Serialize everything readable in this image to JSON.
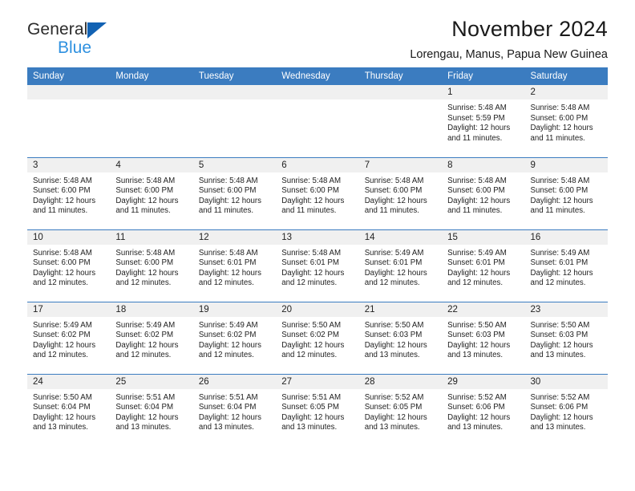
{
  "brand": {
    "name_part1": "General",
    "name_part2": "Blue",
    "triangle_color": "#1262b3",
    "blue_color": "#2f91e0"
  },
  "header": {
    "title": "November 2024",
    "subtitle": "Lorengau, Manus, Papua New Guinea"
  },
  "colors": {
    "header_blue": "#3b7cc0",
    "daynum_band": "#f0f0f0",
    "text": "#222222"
  },
  "weekdays": [
    "Sunday",
    "Monday",
    "Tuesday",
    "Wednesday",
    "Thursday",
    "Friday",
    "Saturday"
  ],
  "weeks": [
    [
      {
        "day": "",
        "sunrise": "",
        "sunset": "",
        "daylight1": "",
        "daylight2": ""
      },
      {
        "day": "",
        "sunrise": "",
        "sunset": "",
        "daylight1": "",
        "daylight2": ""
      },
      {
        "day": "",
        "sunrise": "",
        "sunset": "",
        "daylight1": "",
        "daylight2": ""
      },
      {
        "day": "",
        "sunrise": "",
        "sunset": "",
        "daylight1": "",
        "daylight2": ""
      },
      {
        "day": "",
        "sunrise": "",
        "sunset": "",
        "daylight1": "",
        "daylight2": ""
      },
      {
        "day": "1",
        "sunrise": "Sunrise: 5:48 AM",
        "sunset": "Sunset: 5:59 PM",
        "daylight1": "Daylight: 12 hours",
        "daylight2": "and 11 minutes."
      },
      {
        "day": "2",
        "sunrise": "Sunrise: 5:48 AM",
        "sunset": "Sunset: 6:00 PM",
        "daylight1": "Daylight: 12 hours",
        "daylight2": "and 11 minutes."
      }
    ],
    [
      {
        "day": "3",
        "sunrise": "Sunrise: 5:48 AM",
        "sunset": "Sunset: 6:00 PM",
        "daylight1": "Daylight: 12 hours",
        "daylight2": "and 11 minutes."
      },
      {
        "day": "4",
        "sunrise": "Sunrise: 5:48 AM",
        "sunset": "Sunset: 6:00 PM",
        "daylight1": "Daylight: 12 hours",
        "daylight2": "and 11 minutes."
      },
      {
        "day": "5",
        "sunrise": "Sunrise: 5:48 AM",
        "sunset": "Sunset: 6:00 PM",
        "daylight1": "Daylight: 12 hours",
        "daylight2": "and 11 minutes."
      },
      {
        "day": "6",
        "sunrise": "Sunrise: 5:48 AM",
        "sunset": "Sunset: 6:00 PM",
        "daylight1": "Daylight: 12 hours",
        "daylight2": "and 11 minutes."
      },
      {
        "day": "7",
        "sunrise": "Sunrise: 5:48 AM",
        "sunset": "Sunset: 6:00 PM",
        "daylight1": "Daylight: 12 hours",
        "daylight2": "and 11 minutes."
      },
      {
        "day": "8",
        "sunrise": "Sunrise: 5:48 AM",
        "sunset": "Sunset: 6:00 PM",
        "daylight1": "Daylight: 12 hours",
        "daylight2": "and 11 minutes."
      },
      {
        "day": "9",
        "sunrise": "Sunrise: 5:48 AM",
        "sunset": "Sunset: 6:00 PM",
        "daylight1": "Daylight: 12 hours",
        "daylight2": "and 11 minutes."
      }
    ],
    [
      {
        "day": "10",
        "sunrise": "Sunrise: 5:48 AM",
        "sunset": "Sunset: 6:00 PM",
        "daylight1": "Daylight: 12 hours",
        "daylight2": "and 12 minutes."
      },
      {
        "day": "11",
        "sunrise": "Sunrise: 5:48 AM",
        "sunset": "Sunset: 6:00 PM",
        "daylight1": "Daylight: 12 hours",
        "daylight2": "and 12 minutes."
      },
      {
        "day": "12",
        "sunrise": "Sunrise: 5:48 AM",
        "sunset": "Sunset: 6:01 PM",
        "daylight1": "Daylight: 12 hours",
        "daylight2": "and 12 minutes."
      },
      {
        "day": "13",
        "sunrise": "Sunrise: 5:48 AM",
        "sunset": "Sunset: 6:01 PM",
        "daylight1": "Daylight: 12 hours",
        "daylight2": "and 12 minutes."
      },
      {
        "day": "14",
        "sunrise": "Sunrise: 5:49 AM",
        "sunset": "Sunset: 6:01 PM",
        "daylight1": "Daylight: 12 hours",
        "daylight2": "and 12 minutes."
      },
      {
        "day": "15",
        "sunrise": "Sunrise: 5:49 AM",
        "sunset": "Sunset: 6:01 PM",
        "daylight1": "Daylight: 12 hours",
        "daylight2": "and 12 minutes."
      },
      {
        "day": "16",
        "sunrise": "Sunrise: 5:49 AM",
        "sunset": "Sunset: 6:01 PM",
        "daylight1": "Daylight: 12 hours",
        "daylight2": "and 12 minutes."
      }
    ],
    [
      {
        "day": "17",
        "sunrise": "Sunrise: 5:49 AM",
        "sunset": "Sunset: 6:02 PM",
        "daylight1": "Daylight: 12 hours",
        "daylight2": "and 12 minutes."
      },
      {
        "day": "18",
        "sunrise": "Sunrise: 5:49 AM",
        "sunset": "Sunset: 6:02 PM",
        "daylight1": "Daylight: 12 hours",
        "daylight2": "and 12 minutes."
      },
      {
        "day": "19",
        "sunrise": "Sunrise: 5:49 AM",
        "sunset": "Sunset: 6:02 PM",
        "daylight1": "Daylight: 12 hours",
        "daylight2": "and 12 minutes."
      },
      {
        "day": "20",
        "sunrise": "Sunrise: 5:50 AM",
        "sunset": "Sunset: 6:02 PM",
        "daylight1": "Daylight: 12 hours",
        "daylight2": "and 12 minutes."
      },
      {
        "day": "21",
        "sunrise": "Sunrise: 5:50 AM",
        "sunset": "Sunset: 6:03 PM",
        "daylight1": "Daylight: 12 hours",
        "daylight2": "and 13 minutes."
      },
      {
        "day": "22",
        "sunrise": "Sunrise: 5:50 AM",
        "sunset": "Sunset: 6:03 PM",
        "daylight1": "Daylight: 12 hours",
        "daylight2": "and 13 minutes."
      },
      {
        "day": "23",
        "sunrise": "Sunrise: 5:50 AM",
        "sunset": "Sunset: 6:03 PM",
        "daylight1": "Daylight: 12 hours",
        "daylight2": "and 13 minutes."
      }
    ],
    [
      {
        "day": "24",
        "sunrise": "Sunrise: 5:50 AM",
        "sunset": "Sunset: 6:04 PM",
        "daylight1": "Daylight: 12 hours",
        "daylight2": "and 13 minutes."
      },
      {
        "day": "25",
        "sunrise": "Sunrise: 5:51 AM",
        "sunset": "Sunset: 6:04 PM",
        "daylight1": "Daylight: 12 hours",
        "daylight2": "and 13 minutes."
      },
      {
        "day": "26",
        "sunrise": "Sunrise: 5:51 AM",
        "sunset": "Sunset: 6:04 PM",
        "daylight1": "Daylight: 12 hours",
        "daylight2": "and 13 minutes."
      },
      {
        "day": "27",
        "sunrise": "Sunrise: 5:51 AM",
        "sunset": "Sunset: 6:05 PM",
        "daylight1": "Daylight: 12 hours",
        "daylight2": "and 13 minutes."
      },
      {
        "day": "28",
        "sunrise": "Sunrise: 5:52 AM",
        "sunset": "Sunset: 6:05 PM",
        "daylight1": "Daylight: 12 hours",
        "daylight2": "and 13 minutes."
      },
      {
        "day": "29",
        "sunrise": "Sunrise: 5:52 AM",
        "sunset": "Sunset: 6:06 PM",
        "daylight1": "Daylight: 12 hours",
        "daylight2": "and 13 minutes."
      },
      {
        "day": "30",
        "sunrise": "Sunrise: 5:52 AM",
        "sunset": "Sunset: 6:06 PM",
        "daylight1": "Daylight: 12 hours",
        "daylight2": "and 13 minutes."
      }
    ]
  ]
}
